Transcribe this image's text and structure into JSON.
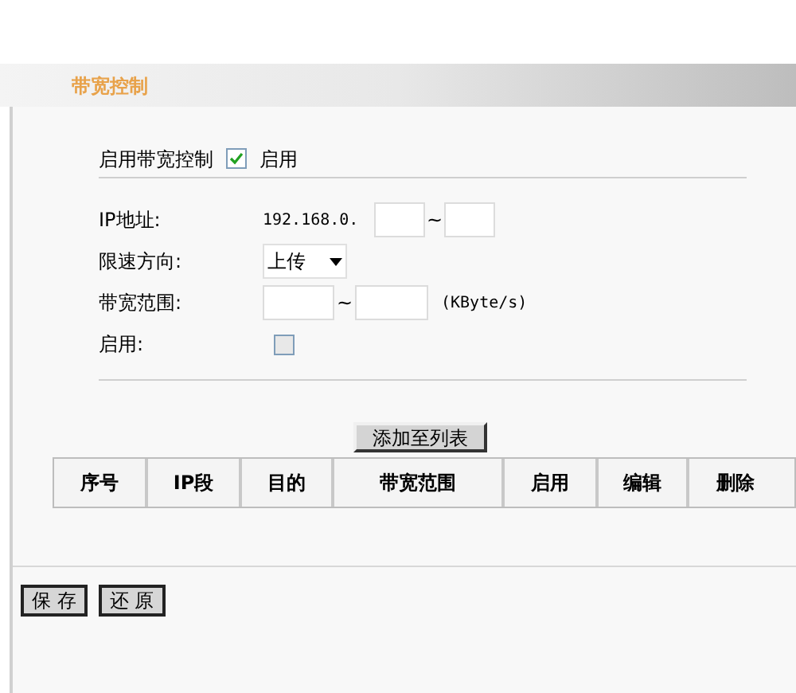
{
  "header": {
    "title": "带宽控制"
  },
  "enable_control": {
    "label": "启用带宽控制",
    "checked": true,
    "option_label": "启用"
  },
  "form": {
    "ip": {
      "label": "IP地址:",
      "prefix": "192.168.0.",
      "separator": "~"
    },
    "direction": {
      "label": "限速方向:",
      "value": "上传"
    },
    "range": {
      "label": "带宽范围:",
      "separator": "~",
      "unit": "(KByte/s)"
    },
    "enabled": {
      "label": "启用:",
      "checked": false
    }
  },
  "add_button": "添加至列表",
  "table": {
    "columns": [
      "序号",
      "IP段",
      "目的",
      "带宽范围",
      "启用",
      "编辑",
      "删除"
    ]
  },
  "buttons": [
    "保 存",
    "还 原"
  ]
}
